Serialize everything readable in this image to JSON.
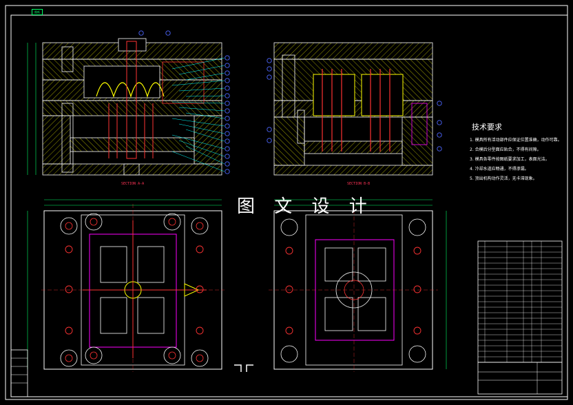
{
  "watermark": "图 文 设 计",
  "section_labels": {
    "a": "SECTION A-A",
    "b": "SECTION B-B"
  },
  "tech_requirements": {
    "title": "技术要求",
    "lines": [
      "1. 模具所有活动部件应保证位置准确，动作可靠。",
      "2. 合模后分型面应贴合，不得有间隙。",
      "3. 模具各零件按图纸要求加工，表面光洁。",
      "4. 冷却水道应畅通，不得渗漏。",
      "5. 顶出机构动作灵活，无卡滞现象。"
    ]
  },
  "stamp": "图纸",
  "colors": {
    "background": "#000000",
    "frame": "#ffffff",
    "hatch": "#ffff00",
    "parts": "#ff3333",
    "leaders": "#00ffff",
    "balloons": "#4d66ff",
    "dims": "#00ff66",
    "outline": "#ff00ff"
  }
}
